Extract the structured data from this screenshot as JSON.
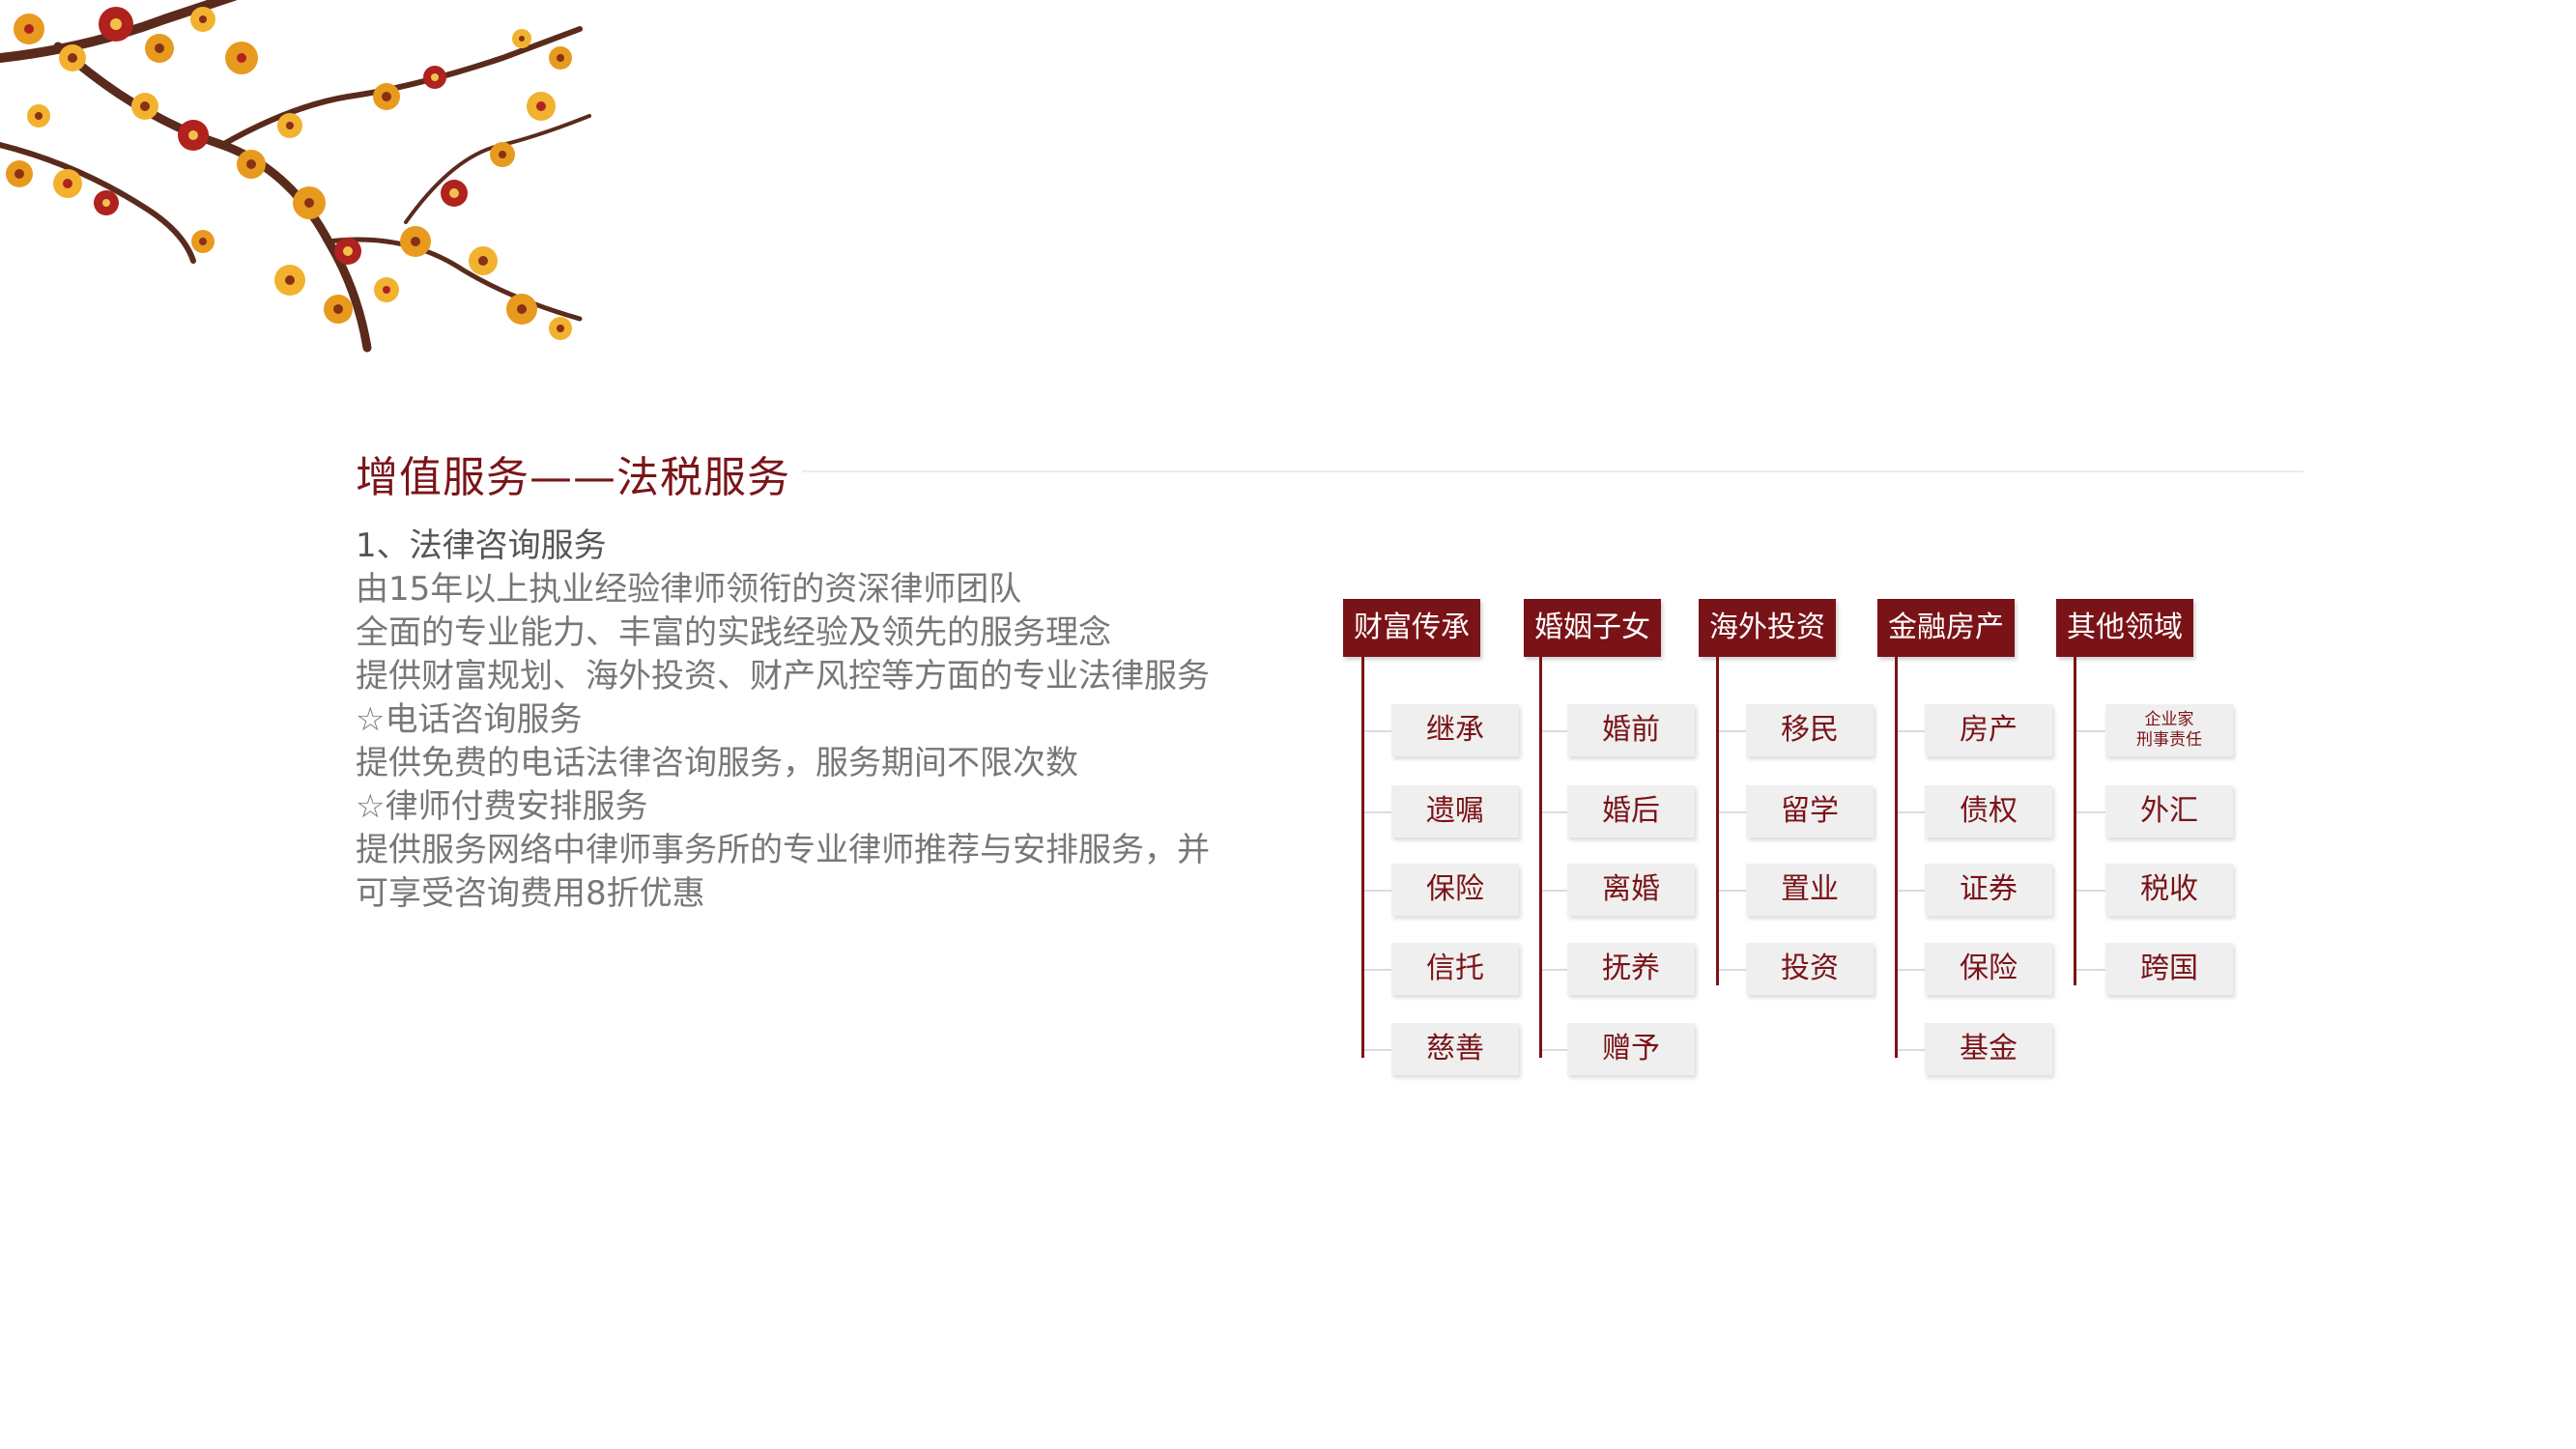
{
  "title": "增值服务——法税服务",
  "intro": {
    "heading": "1、法律咨询服务",
    "lines": [
      "由15年以上执业经验律师领衔的资深律师团队",
      "全面的专业能力、丰富的实践经验及领先的服务理念",
      "提供财富规划、海外投资、财产风控等方面的专业法律服务",
      "☆电话咨询服务",
      "提供免费的电话法律咨询服务，服务期间不限次数",
      "☆律师付费安排服务",
      "提供服务网络中律师事务所的专业律师推荐与安排服务，并",
      "可享受咨询费用8折优惠"
    ]
  },
  "categories": [
    {
      "label": "财富传承",
      "items": [
        "继承",
        "遗嘱",
        "保险",
        "信托",
        "慈善"
      ]
    },
    {
      "label": "婚姻子女",
      "items": [
        "婚前",
        "婚后",
        "离婚",
        "抚养",
        "赠予"
      ]
    },
    {
      "label": "海外投资",
      "items": [
        "移民",
        "留学",
        "置业",
        "投资"
      ]
    },
    {
      "label": "金融房产",
      "items": [
        "房产",
        "债权",
        "证券",
        "保险",
        "基金"
      ]
    },
    {
      "label": "其他领域",
      "items": [
        "企业家\n刑事责任",
        "外汇",
        "税收",
        "跨国"
      ]
    }
  ],
  "colors": {
    "accent": "#7a1317",
    "item_bg": "#efefef",
    "body_text": "#777777"
  }
}
